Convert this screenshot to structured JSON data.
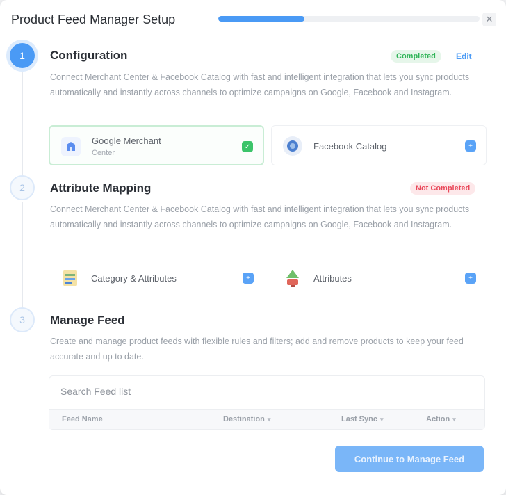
{
  "dialog": {
    "title": "Product Feed Manager Setup",
    "close_icon": "close-icon",
    "progress_percent": 33
  },
  "steps": [
    {
      "number": "1",
      "title": "Configuration",
      "status": "Completed",
      "action": "Edit",
      "description": "Connect Merchant Center & Facebook Catalog with fast and intelligent integration that lets you sync products automatically and instantly across channels to optimize campaigns on Google, Facebook and Instagram.",
      "cards": [
        {
          "name": "Google Merchant",
          "sub": "Center",
          "icon": "google-merchant-icon",
          "state": "selected"
        },
        {
          "name": "Facebook Catalog",
          "sub": "",
          "icon": "facebook-catalog-icon",
          "state": "plain"
        }
      ]
    },
    {
      "number": "2",
      "title": "Attribute Mapping",
      "status": "Not Completed",
      "description": "Connect Merchant Center & Facebook Catalog with fast and intelligent integration that lets you sync products automatically and instantly across channels to optimize campaigns on Google, Facebook and Instagram.",
      "cards": [
        {
          "name": "Category & Attributes",
          "sub": "",
          "icon": "category-attributes-icon",
          "state": "plain"
        },
        {
          "name": "Attributes",
          "sub": "",
          "icon": "attributes-icon",
          "state": "plain"
        }
      ]
    },
    {
      "number": "3",
      "title": "Manage Feed",
      "description": "Create and manage product feeds with flexible rules and filters; add and remove products to keep your feed accurate and up to date.",
      "table": {
        "search_placeholder": "Search Feed list",
        "columns": [
          "Feed Name",
          "Destination",
          "Last Sync",
          "Action"
        ]
      }
    }
  ],
  "footer": {
    "primary_label": "Continue to Manage Feed"
  },
  "colors": {
    "accent": "#4a9af5",
    "success": "#2fb457",
    "danger": "#e9485a"
  }
}
